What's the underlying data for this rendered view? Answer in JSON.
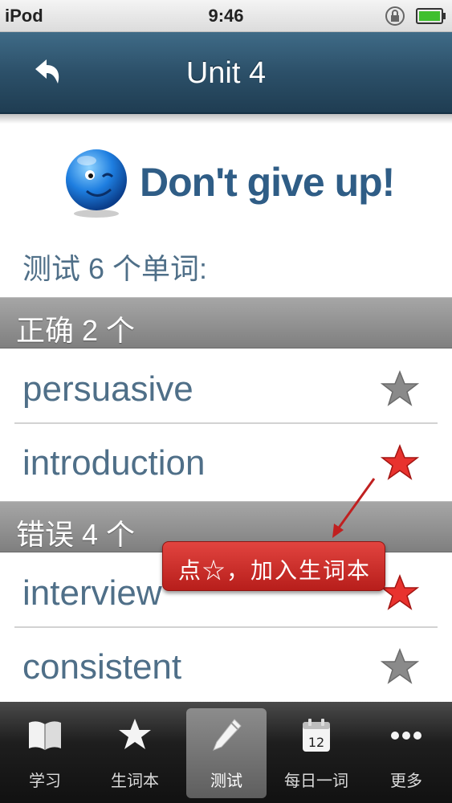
{
  "status_bar": {
    "carrier": "iPod",
    "time": "9:46"
  },
  "nav": {
    "title": "Unit 4",
    "back_icon": "back-arrow-icon"
  },
  "header": {
    "encouragement": "Don't give up!",
    "summary": "测试 6 个单词:"
  },
  "sections": [
    {
      "title": "正确 2 个",
      "words": [
        {
          "word": "persuasive",
          "starred": false
        },
        {
          "word": "introduction",
          "starred": true
        }
      ]
    },
    {
      "title": "错误 4 个",
      "words": [
        {
          "word": "interview",
          "starred": true
        },
        {
          "word": "consistent",
          "starred": false
        }
      ]
    }
  ],
  "tooltip": {
    "text": "点☆，加入生词本"
  },
  "tabs": [
    {
      "label": "学习",
      "icon": "book-icon",
      "active": false
    },
    {
      "label": "生词本",
      "icon": "star-icon",
      "active": false
    },
    {
      "label": "测试",
      "icon": "pencil-icon",
      "active": true
    },
    {
      "label": "每日一词",
      "icon": "calendar-icon",
      "active": false,
      "calendar_day": "12"
    },
    {
      "label": "更多",
      "icon": "more-dots-icon",
      "active": false
    }
  ],
  "colors": {
    "nav_bar": "#2c5069",
    "word_text": "#4f6f88",
    "star_active": "#e8322e",
    "star_inactive": "#8a8a8a",
    "tooltip": "#cc2b27"
  }
}
